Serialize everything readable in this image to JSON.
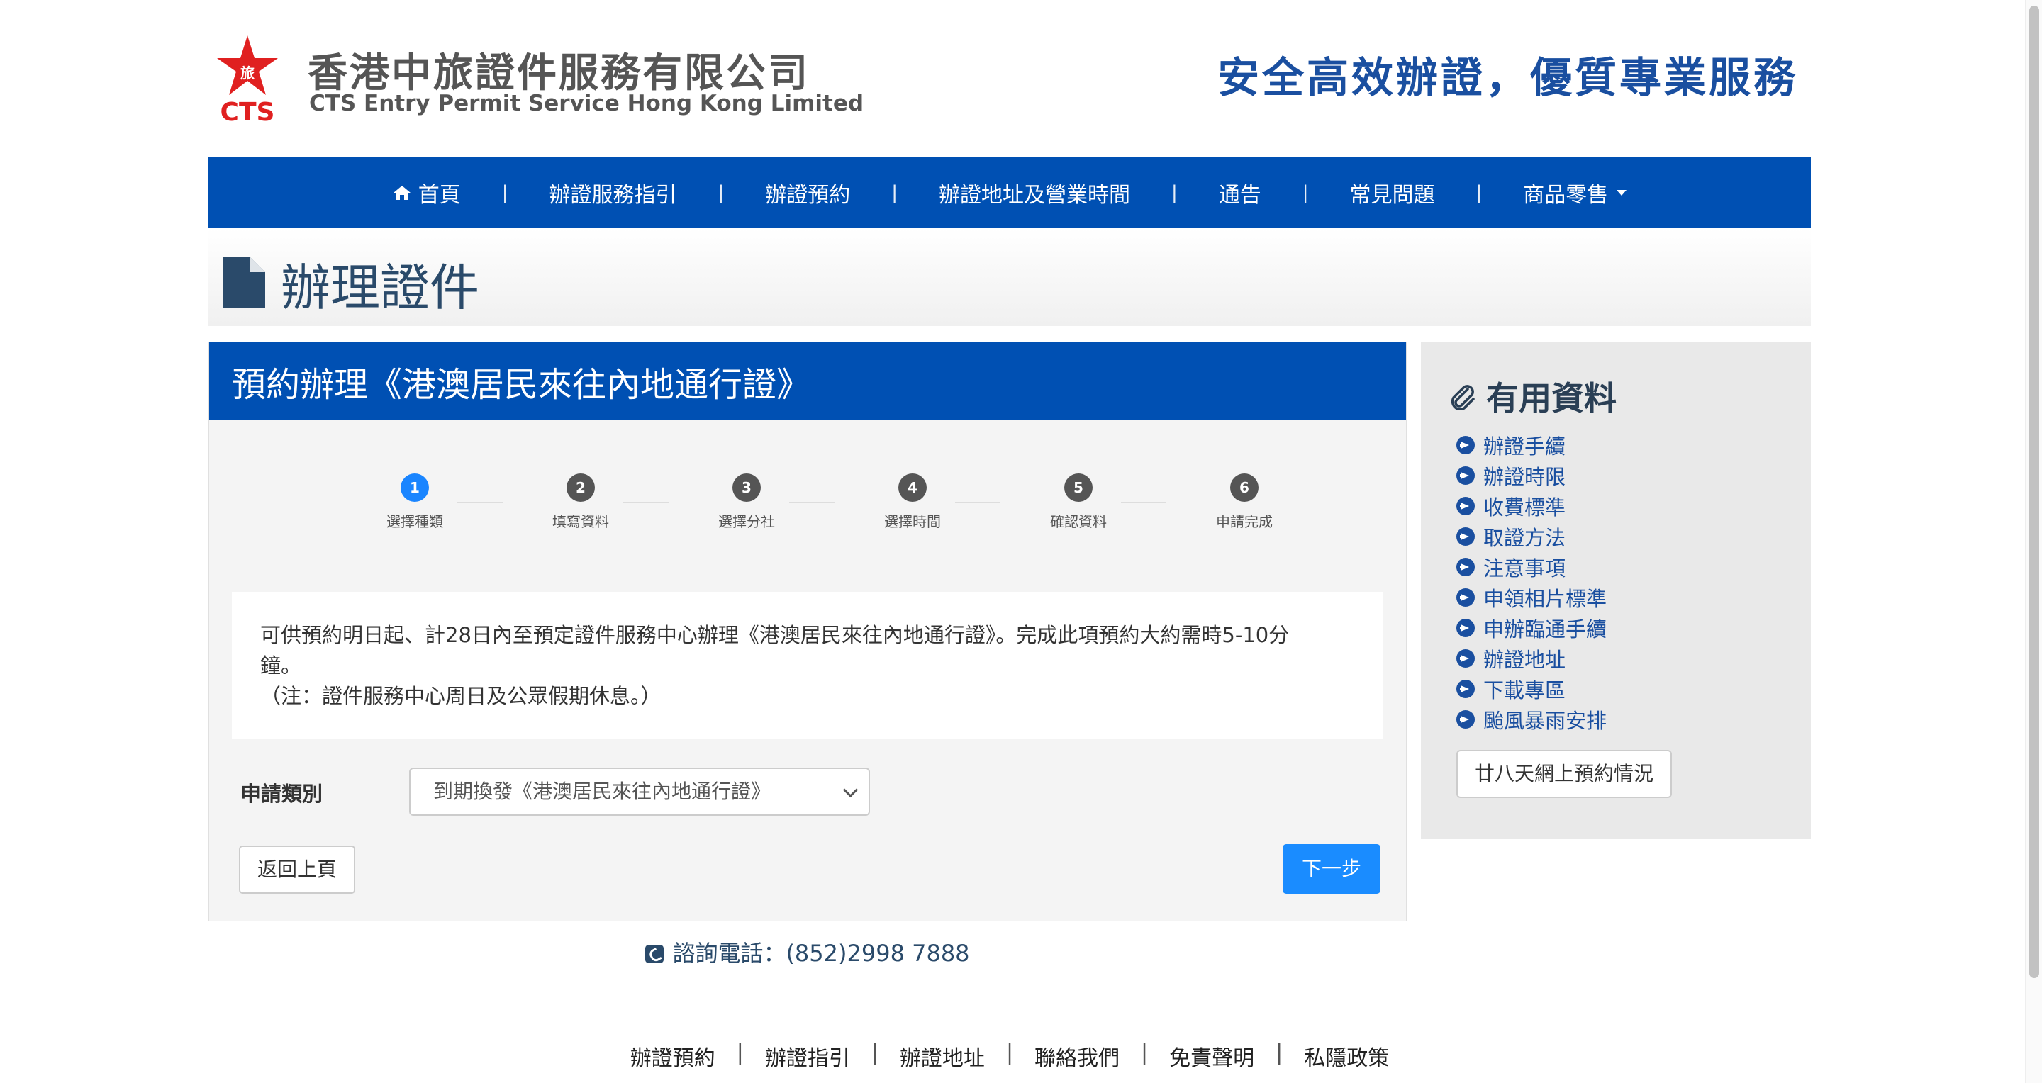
{
  "header": {
    "logo_text": "CTS",
    "company_zh": "香港中旅證件服務有限公司",
    "company_en": "CTS Entry Permit Service Hong Kong Limited",
    "slogan": "安全高效辦證，優質專業服務",
    "brand_color": "#0050b3",
    "logo_color": "#e02020"
  },
  "nav": {
    "items": [
      {
        "label": "首頁",
        "icon": "home-icon"
      },
      {
        "label": "辦證服務指引"
      },
      {
        "label": "辦證預約"
      },
      {
        "label": "辦證地址及營業時間"
      },
      {
        "label": "通告"
      },
      {
        "label": "常見問題"
      },
      {
        "label": "商品零售",
        "icon": "caret-down-icon"
      }
    ],
    "separator": "|"
  },
  "page": {
    "title": "辦理證件",
    "title_icon": "document-icon"
  },
  "main": {
    "heading": "預約辦理《港澳居民來往內地通行證》",
    "steps": [
      {
        "num": "1",
        "label": "選擇種類",
        "active": true
      },
      {
        "num": "2",
        "label": "填寫資料",
        "active": false
      },
      {
        "num": "3",
        "label": "選擇分社",
        "active": false
      },
      {
        "num": "4",
        "label": "選擇時間",
        "active": false
      },
      {
        "num": "5",
        "label": "確認資料",
        "active": false
      },
      {
        "num": "6",
        "label": "申請完成",
        "active": false
      }
    ],
    "info_line1": "可供預約明日起、計28日內至預定證件服務中心辦理《港澳居民來往內地通行證》。完成此項預約大約需時5-10分",
    "info_line2": "鐘。",
    "info_line3": "（注：證件服務中心周日及公眾假期休息。）",
    "form_label": "申請類別",
    "select_value": "到期換發《港澳居民來往內地通行證》",
    "back_button": "返回上頁",
    "next_button": "下一步"
  },
  "sidebar": {
    "title": "有用資料",
    "title_icon": "paperclip-icon",
    "links": [
      "辦證手續",
      "辦證時限",
      "收費標準",
      "取證方法",
      "注意事項",
      "申領相片標準",
      "申辦臨通手續",
      "辦證地址",
      "下載專區",
      "颱風暴雨安排"
    ],
    "button": "廿八天網上預約情況"
  },
  "hotline": {
    "label": "諮詢電話：(852)2998 7888",
    "icon": "phone-icon"
  },
  "footer": {
    "links": [
      "辦證預約",
      "辦證指引",
      "辦證地址",
      "聯絡我們",
      "免責聲明",
      "私隱政策"
    ],
    "separator": "|"
  }
}
